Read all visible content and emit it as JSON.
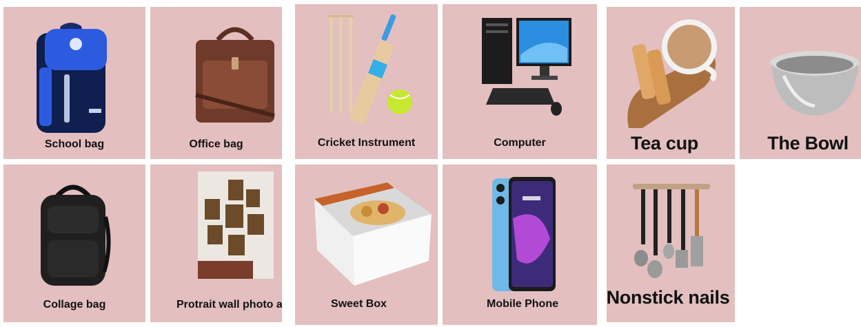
{
  "colors": {
    "card_bg": "#e3bfbf",
    "page_bg": "#ffffff"
  },
  "items": [
    {
      "label": "School bag",
      "icon": "school-backpack-icon"
    },
    {
      "label": "Office bag",
      "icon": "leather-office-bag-icon"
    },
    {
      "label": "Cricket Instrument",
      "icon": "cricket-bat-ball-stumps-icon"
    },
    {
      "label": "Computer",
      "icon": "desktop-computer-icon"
    },
    {
      "label": "Tea cup",
      "icon": "tea-cup-icon"
    },
    {
      "label": "The Bowl",
      "icon": "steel-bowl-icon"
    },
    {
      "label": "Collage bag",
      "icon": "black-backpack-icon"
    },
    {
      "label": "Protrait wall photo alva",
      "icon": "wall-photo-frames-icon"
    },
    {
      "label": "Sweet Box",
      "icon": "sweet-box-icon"
    },
    {
      "label": "Mobile Phone",
      "icon": "mobile-phone-icon"
    },
    {
      "label": "Nonstick nails",
      "icon": "kitchen-utensils-icon"
    }
  ]
}
